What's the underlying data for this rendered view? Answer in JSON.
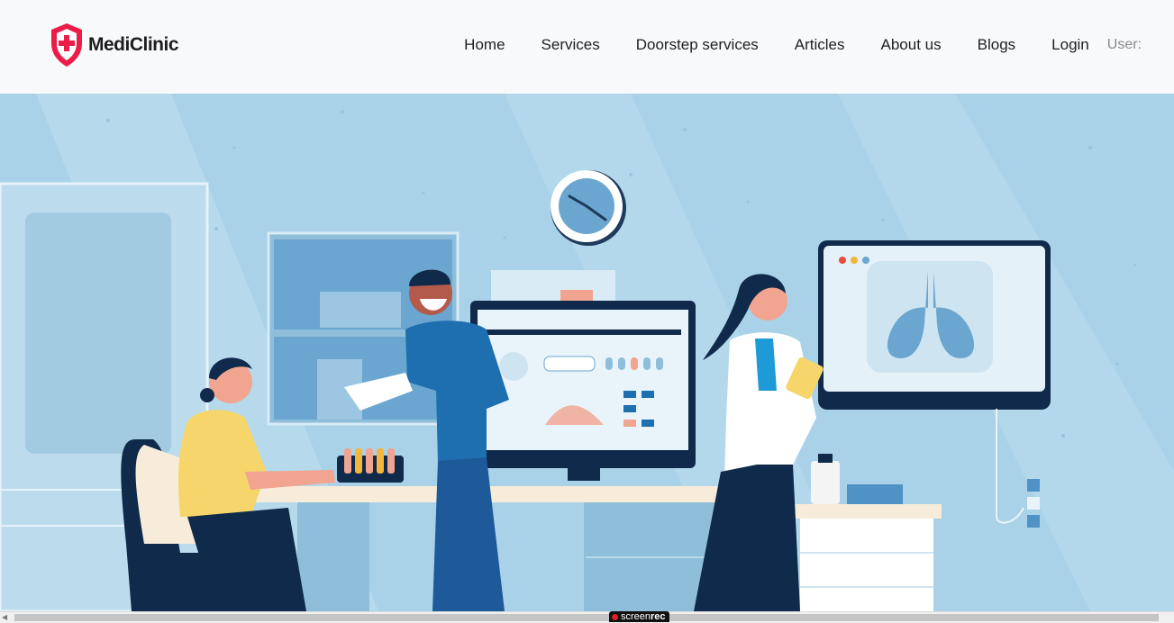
{
  "brand": {
    "name": "MediClinic",
    "accent_color": "#ec1c4a",
    "icon": "shield-cross-icon"
  },
  "nav": {
    "items": [
      {
        "label": "Home"
      },
      {
        "label": "Services"
      },
      {
        "label": "Doorstep services"
      },
      {
        "label": "Articles"
      },
      {
        "label": "About us"
      },
      {
        "label": "Blogs"
      },
      {
        "label": "Login"
      }
    ],
    "user_label": "User:"
  },
  "hero": {
    "illustration": "clinic-scene-illustration",
    "background_color": "#a9d2e8"
  },
  "overlay": {
    "recorder_part1": "screen",
    "recorder_part2": "rec"
  }
}
